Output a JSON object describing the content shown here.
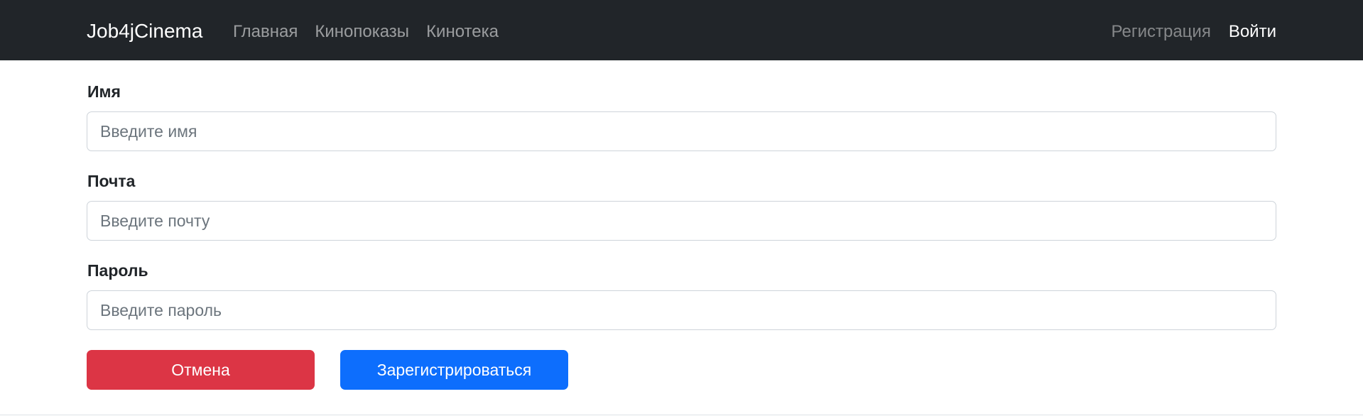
{
  "navbar": {
    "brand": "Job4jCinema",
    "links": [
      "Главная",
      "Кинопоказы",
      "Кинотека"
    ],
    "register_label": "Регистрация",
    "login_label": "Войти",
    "background_color": "#212529"
  },
  "form": {
    "name": {
      "label": "Имя",
      "placeholder": "Введите имя",
      "value": ""
    },
    "email": {
      "label": "Почта",
      "placeholder": "Введите почту",
      "value": ""
    },
    "password": {
      "label": "Пароль",
      "placeholder": "Введите пароль",
      "value": ""
    }
  },
  "buttons": {
    "cancel_label": "Отмена",
    "submit_label": "Зарегистрироваться",
    "cancel_color": "#dc3545",
    "submit_color": "#0d6efd"
  }
}
